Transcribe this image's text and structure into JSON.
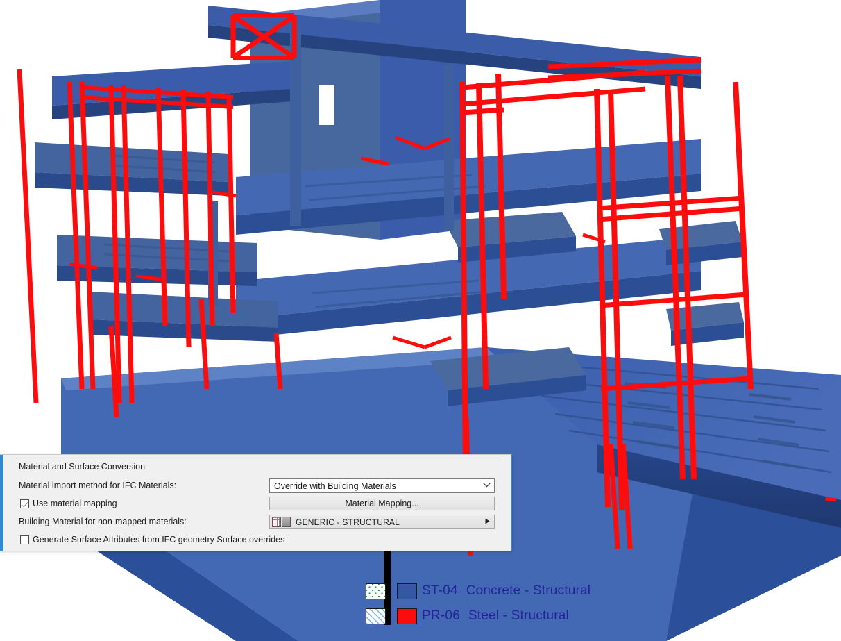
{
  "viewport": {
    "name": "ifc-3d-model-viewport",
    "description": "3D structural building model shown in axonometric view",
    "background_color": "#ffffff",
    "concrete_color": "#3558a4",
    "concrete_shade_dark": "#24417f",
    "concrete_shade_light": "#4f73bc",
    "steel_color": "#fb0d0d"
  },
  "dialog": {
    "group_title": "Material and Surface Conversion",
    "fields": {
      "import_method_label": "Material import method for IFC Materials:",
      "import_method_value": "Override with Building Materials",
      "import_method_chevron": "chevron-down-icon",
      "use_material_mapping_label": "Use material mapping",
      "use_material_mapping_checked": true,
      "material_mapping_button": "Material Mapping...",
      "building_material_label": "Building Material for non-mapped materials:",
      "building_material_value": "GENERIC - STRUCTURAL",
      "building_material_arrow": "triangle-right-icon",
      "generate_surface_attributes_label": "Generate Surface Attributes from IFC geometry Surface overrides",
      "generate_surface_attributes_checked": false
    },
    "accent_color": "#2f88d4",
    "background_color": "#f0f0f0"
  },
  "annotation": {
    "pointer_line_color": "#000000"
  },
  "legend": {
    "items": [
      {
        "pattern": "dotted-concrete-fill",
        "color": "#3558a4",
        "code": "ST-04",
        "name": "Concrete - Structural"
      },
      {
        "pattern": "diagonal-hatch-fill",
        "color": "#fb0d0d",
        "code": "PR-06",
        "name": "Steel - Structural"
      }
    ],
    "text_color": "#24249a"
  }
}
